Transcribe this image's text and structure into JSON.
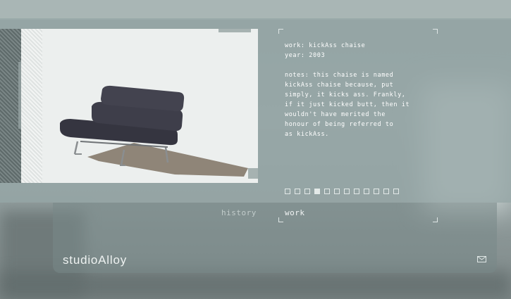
{
  "work": {
    "title_line": "work: kickAss chaise",
    "year_line": "year: 2003",
    "notes_line": "notes: this chaise is named\nkickAss chaise because, put\nsimply, it kicks ass. Frankly,\nif it just kicked butt, then it\nwouldn't have merited the\nhonour of being referred to\nas kickAss."
  },
  "pager": {
    "count": 12,
    "active_index": 3
  },
  "nav": {
    "history": "history",
    "work": "work"
  },
  "brand": "studioAlloy",
  "icons": {
    "mail": "mail-icon"
  },
  "colors": {
    "panel": "#96a6a6",
    "text": "#ffffff",
    "accent_dim": "#c2cccb"
  }
}
